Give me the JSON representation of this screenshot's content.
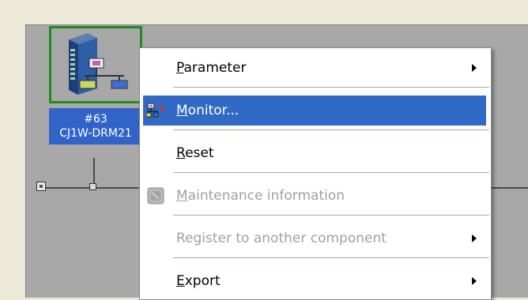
{
  "node": {
    "address": "#63",
    "model": "CJ1W-DRM21"
  },
  "context_menu": {
    "items": [
      {
        "label_u": "P",
        "label_rest": "arameter",
        "has_submenu": true,
        "state": "normal"
      },
      {
        "label_u": "M",
        "label_rest": "onitor...",
        "has_submenu": false,
        "state": "selected",
        "icon": "network-monitor-icon"
      },
      {
        "label_u": "R",
        "label_rest": "eset",
        "has_submenu": false,
        "state": "normal"
      },
      {
        "label_u": "M",
        "label_rest": "aintenance information",
        "has_submenu": false,
        "state": "disabled",
        "icon": "maintenance-icon"
      },
      {
        "label_u": "",
        "label_rest": "Register to another component",
        "has_submenu": true,
        "state": "disabled"
      },
      {
        "label_u": "E",
        "label_rest": "xport",
        "has_submenu": true,
        "state": "normal"
      }
    ]
  },
  "colors": {
    "selection": "#316AC5",
    "node_border": "#1E8C1E",
    "node_label_bg": "#3163C8",
    "canvas": "#A8A8A8"
  }
}
